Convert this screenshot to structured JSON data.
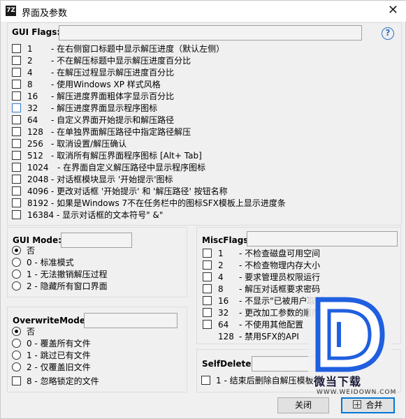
{
  "window": {
    "title": "界面及参数",
    "app_icon": "7Z"
  },
  "gui_flags": {
    "label": "GUI Flags:",
    "value": "",
    "items": [
      {
        "num": "1",
        "desc": "- 在右侧窗口标题中显示解压进度（默认左侧）"
      },
      {
        "num": "2",
        "desc": "- 不在解压标题中显示解压进度百分比"
      },
      {
        "num": "4",
        "desc": "- 在解压过程显示解压进度百分比"
      },
      {
        "num": "8",
        "desc": "- 使用Windows XP 样式风格"
      },
      {
        "num": "16",
        "desc": "- 解压进度界面粗体字显示百分比"
      },
      {
        "num": "32",
        "desc": "- 解压进度界面显示程序图标"
      },
      {
        "num": "64",
        "desc": "- 自定义界面开始提示和解压路径"
      },
      {
        "num": "128",
        "desc": "- 在单独界面解压路径中指定路径解压"
      },
      {
        "num": "256",
        "desc": "- 取消设置/解压确认"
      },
      {
        "num": "512",
        "desc": "- 取消所有解压界面程序图标 [Alt+ Tab]"
      },
      {
        "num": "1024",
        "desc": "- 在界面自定义解压路径中显示程序图标"
      },
      {
        "num": "2048",
        "desc": "- 对话框模块显示 '开始提示'图标"
      },
      {
        "num": "4096",
        "desc": "- 更改对话框 '开始提示' 和 '解压路径' 按钮名称"
      },
      {
        "num": "8192",
        "desc": "- 如果是Windows 7不在任务栏中的图标SFX模板上显示进度条"
      },
      {
        "num": "16384",
        "desc": "- 显示对话框的文本符号\" &\""
      }
    ]
  },
  "gui_mode": {
    "label": "GUI Mode:",
    "value": "",
    "options": [
      {
        "text": "否",
        "selected": true
      },
      {
        "text": "0 - 标准模式",
        "selected": false
      },
      {
        "text": "1 - 无法撤销解压过程",
        "selected": false
      },
      {
        "text": "2 - 隐藏所有窗口界面",
        "selected": false
      }
    ]
  },
  "overwrite_mode": {
    "label": "OverwriteMode:",
    "value": "",
    "options": [
      {
        "text": "否",
        "selected": true
      },
      {
        "text": "0 - 覆盖所有文件",
        "selected": false
      },
      {
        "text": "1 - 跳过已有文件",
        "selected": false
      },
      {
        "text": "2 - 仅覆盖旧文件",
        "selected": false
      }
    ],
    "checkbox": "8 - 忽略锁定的文件"
  },
  "misc_flags": {
    "label": "MiscFlags:",
    "value": "",
    "items": [
      {
        "num": "1",
        "desc": "- 不检查磁盘可用空间"
      },
      {
        "num": "2",
        "desc": "- 不检查物理内存大小"
      },
      {
        "num": "4",
        "desc": "- 要求管理员权限运行"
      },
      {
        "num": "8",
        "desc": "- 解压对话框要求密码"
      },
      {
        "num": "16",
        "desc": "- 不显示\"已被用户取消\""
      },
      {
        "num": "32",
        "desc": "- 更改加工参数的顺序"
      },
      {
        "num": "64",
        "desc": "- 不使用其他配置"
      },
      {
        "num": "128",
        "desc": "- 禁用SFX的API"
      }
    ]
  },
  "self_delete": {
    "label": "SelfDelete:",
    "value": "",
    "checkbox": "1 - 结束后删除自解压模板"
  },
  "buttons": {
    "close": "关闭",
    "merge": "合并"
  },
  "watermark": {
    "brand": "微当下载",
    "url": "WWW.WEIDOWN.COM"
  },
  "colors": {
    "accent": "#0078d7",
    "help": "#2d6fc7",
    "watermark_blue": "#1f5fe0"
  }
}
